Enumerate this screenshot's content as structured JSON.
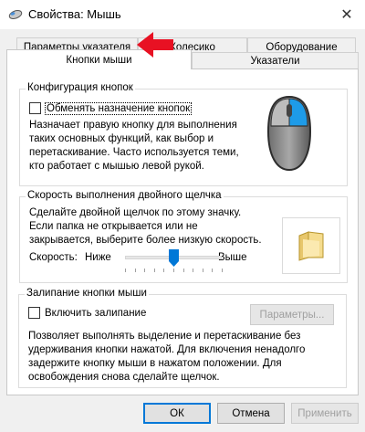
{
  "window": {
    "title": "Свойства: Мышь",
    "close_glyph": "✕"
  },
  "tabs": {
    "pointer_params": "Параметры указателя",
    "wheel": "Колесико",
    "hardware": "Оборудование",
    "buttons": "Кнопки мыши",
    "pointers": "Указатели"
  },
  "button_config": {
    "title": "Конфигурация кнопок",
    "swap_label": "Обменять назначение кнопок",
    "swap_checked": false,
    "desc_lines": [
      "Назначает правую кнопку для выполнения",
      "таких основных функций, как выбор и",
      "перетаскивание. Часто используется теми,",
      "кто работает с мышью левой рукой."
    ]
  },
  "double_click": {
    "title": "Скорость выполнения двойного щелчка",
    "desc_lines": [
      "Сделайте двойной щелчок по этому значку.",
      "Если папка не открывается или не",
      "закрывается, выберите более низкую скорость."
    ],
    "speed_label": "Скорость:",
    "slow_label": "Ниже",
    "fast_label": "Выше",
    "speed_fraction": 0.5
  },
  "click_lock": {
    "title": "Залипание кнопки мыши",
    "enable_label": "Включить залипание",
    "enable_checked": false,
    "params_button": "Параметры...",
    "desc_lines": [
      "Позволяет выполнять выделение и перетаскивание без",
      "удерживания кнопки нажатой. Для включения ненадолго",
      "задержите кнопку мыши в нажатом положении. Для",
      "освобождения снова сделайте щелчок."
    ]
  },
  "footer": {
    "ok": "ОК",
    "cancel": "Отмена",
    "apply": "Применить"
  },
  "colors": {
    "accent": "#0078d7",
    "annotation_arrow": "#e81123"
  },
  "icons": {
    "title": "mouse-icon",
    "mouse_illustration": "mouse-icon",
    "folder": "folder-icon",
    "annotation": "arrow-left-icon"
  }
}
